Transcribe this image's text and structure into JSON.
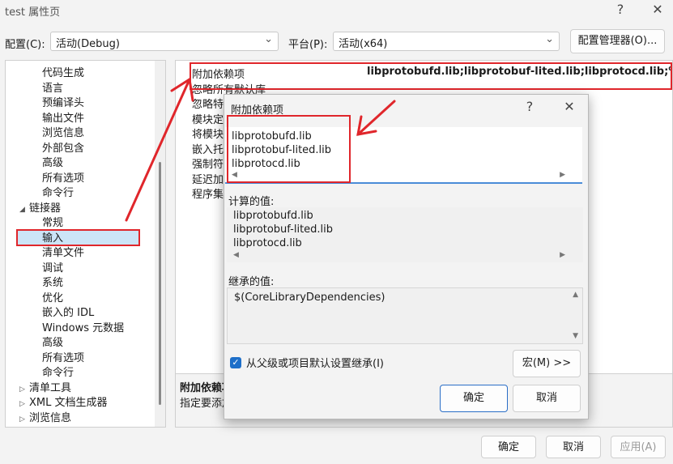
{
  "window": {
    "title": "test 属性页",
    "help_glyph": "?",
    "close_glyph": "✕"
  },
  "toolbar": {
    "config_label": "配置(C):",
    "config_value": "活动(Debug)",
    "platform_label": "平台(P):",
    "platform_value": "活动(x64)",
    "config_manager_label": "配置管理器(O)..."
  },
  "tree": {
    "items": [
      {
        "label": "代码生成"
      },
      {
        "label": "语言"
      },
      {
        "label": "预编译头"
      },
      {
        "label": "输出文件"
      },
      {
        "label": "浏览信息"
      },
      {
        "label": "外部包含"
      },
      {
        "label": "高级"
      },
      {
        "label": "所有选项"
      },
      {
        "label": "命令行"
      },
      {
        "label": "链接器"
      },
      {
        "label": "常规"
      },
      {
        "label": "输入"
      },
      {
        "label": "清单文件"
      },
      {
        "label": "调试"
      },
      {
        "label": "系统"
      },
      {
        "label": "优化"
      },
      {
        "label": "嵌入的 IDL"
      },
      {
        "label": "Windows 元数据"
      },
      {
        "label": "高级"
      },
      {
        "label": "所有选项"
      },
      {
        "label": "命令行"
      },
      {
        "label": "清单工具"
      },
      {
        "label": "XML 文档生成器"
      },
      {
        "label": "浏览信息"
      }
    ]
  },
  "properties": {
    "rows": [
      {
        "name": "附加依赖项",
        "value": "libprotobufd.lib;libprotobuf-lited.lib;libprotocd.lib;%(Add"
      },
      {
        "name": "忽略所有默认库"
      },
      {
        "name": "忽略特"
      },
      {
        "name": "模块定"
      },
      {
        "name": "将模块"
      },
      {
        "name": "嵌入托"
      },
      {
        "name": "强制符"
      },
      {
        "name": "延迟加"
      },
      {
        "name": "程序集"
      }
    ],
    "description_title": "附加依赖项",
    "description_text": "指定要添加"
  },
  "footer": {
    "ok_label": "确定",
    "cancel_label": "取消",
    "apply_label": "应用(A)"
  },
  "dialog": {
    "title": "附加依赖项",
    "help_glyph": "?",
    "close_glyph": "✕",
    "edit_lines": [
      "libprotobufd.lib",
      "libprotobuf-lited.lib",
      "libprotocd.lib"
    ],
    "computed_label": "计算的值:",
    "computed_lines": [
      "libprotobufd.lib",
      "libprotobuf-lited.lib",
      "libprotocd.lib"
    ],
    "inherited_label": "继承的值:",
    "inherited_value": "$(CoreLibraryDependencies)",
    "inherit_checkbox_label": "从父级或项目默认设置继承(I)",
    "macro_button_label": "宏(M) >>",
    "ok_label": "确定",
    "cancel_label": "取消"
  },
  "colors": {
    "annotation_red": "#e0262b",
    "accent_blue": "#1e6fc9"
  }
}
